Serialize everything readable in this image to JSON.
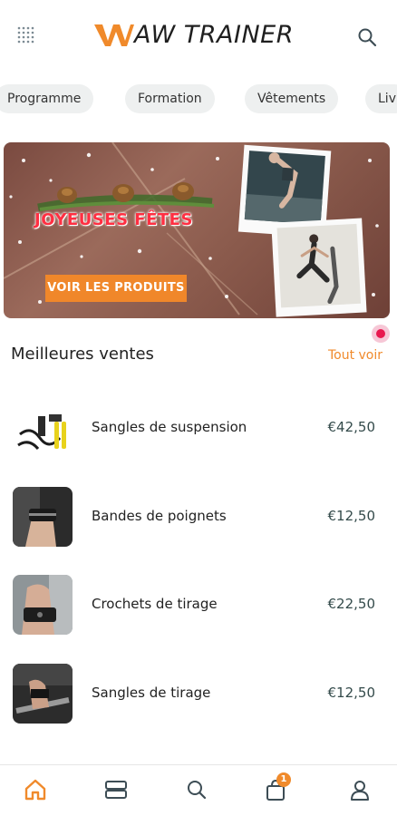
{
  "brand": {
    "logo_text": "AW TRAINER"
  },
  "header": {
    "menu_icon": "grid-icon",
    "search_icon": "search-icon"
  },
  "categories": [
    "Programme",
    "Formation",
    "Vêtements",
    "Liv"
  ],
  "banner": {
    "title": "JOYEUSES FÊTES",
    "cta_label": "VOIR LES PRODUITS"
  },
  "best_sellers": {
    "title": "Meilleures ventes",
    "see_all": "Tout voir",
    "items": [
      {
        "name": "Sangles de suspension",
        "price": "€42,50"
      },
      {
        "name": "Bandes de poignets",
        "price": "€12,50"
      },
      {
        "name": "Crochets de tirage",
        "price": "€22,50"
      },
      {
        "name": "Sangles de tirage",
        "price": "€12,50"
      }
    ]
  },
  "bottom_nav": {
    "items": [
      "home-icon",
      "catalog-icon",
      "search-icon",
      "cart-icon",
      "profile-icon"
    ],
    "cart_badge": "1"
  },
  "colors": {
    "accent": "#f08a2b",
    "price": "#344b4b",
    "chip_bg": "#eef0f0"
  }
}
